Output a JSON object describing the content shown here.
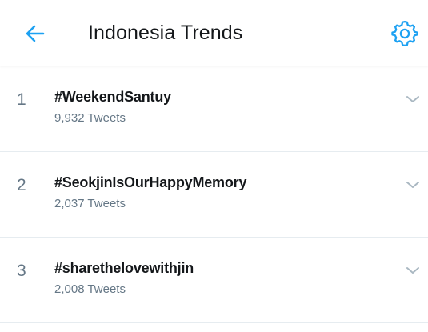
{
  "header": {
    "title": "Indonesia Trends",
    "back_icon": "arrow-left-icon",
    "settings_icon": "gear-icon",
    "accent_color": "#1da1f2"
  },
  "trends": [
    {
      "rank": "1",
      "tag": "#WeekendSantuy",
      "count": "9,932 Tweets"
    },
    {
      "rank": "2",
      "tag": "#SeokjinIsOurHappyMemory",
      "count": "2,037 Tweets"
    },
    {
      "rank": "3",
      "tag": "#sharethelovewithjin",
      "count": "2,008 Tweets"
    }
  ],
  "row_icon": "chevron-down-icon"
}
